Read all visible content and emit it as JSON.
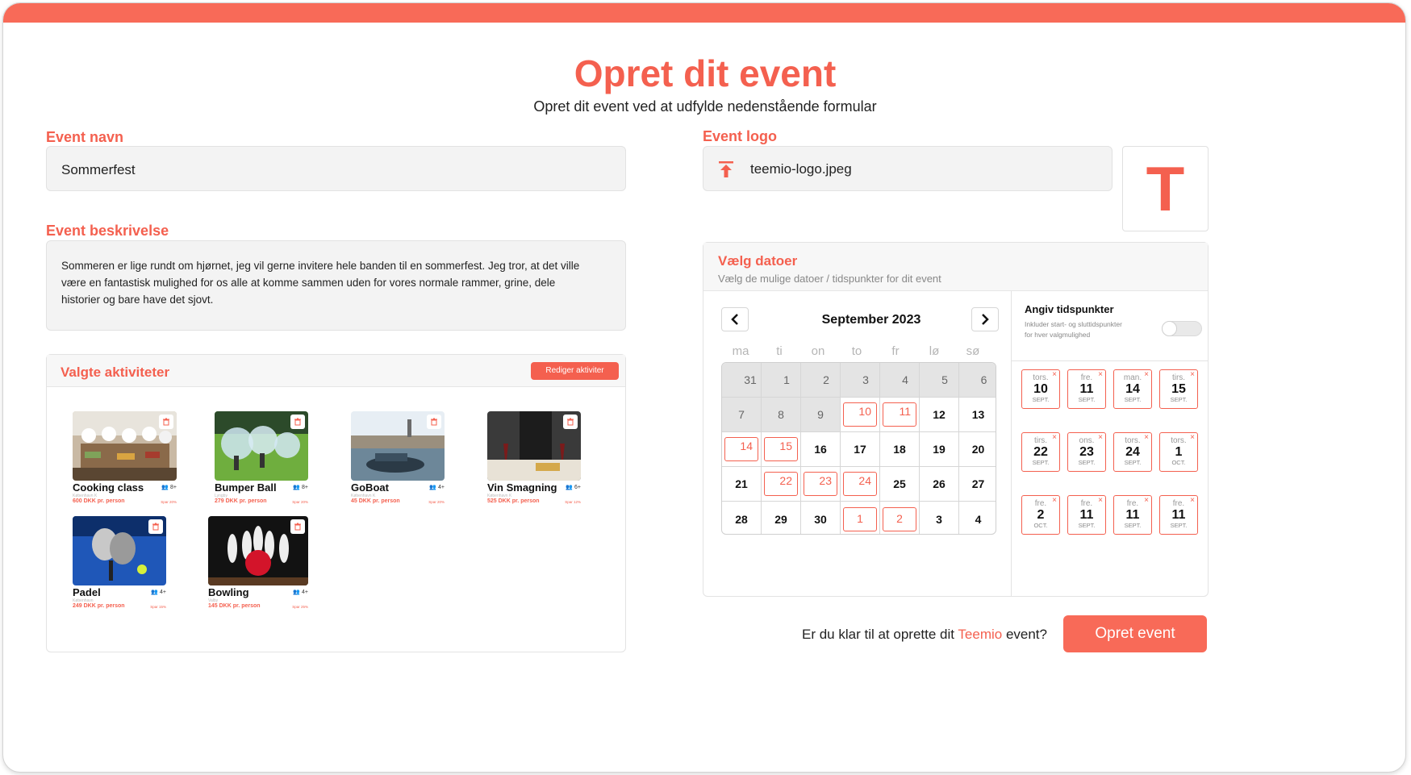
{
  "header": {
    "title": "Opret dit event",
    "subtitle": "Opret dit event ved at udfylde nedenstående formular"
  },
  "event_name": {
    "label": "Event navn",
    "value": "Sommerfest"
  },
  "event_description": {
    "label": "Event beskrivelse",
    "value": "Sommeren er lige rundt om hjørnet, jeg vil gerne invitere hele banden til en sommerfest. Jeg tror, at det ville være en fantastisk mulighed for os alle at komme sammen uden for vores normale rammer, grine, dele historier og bare have det sjovt."
  },
  "activities": {
    "title": "Valgte aktiviteter",
    "edit_label": "Rediger aktiviter",
    "items": [
      {
        "name": "Cooking class",
        "capacity": "8+",
        "location": "København K",
        "price": "600 DKK pr. person",
        "save": "Spar 20%"
      },
      {
        "name": "Bumper Ball",
        "capacity": "8+",
        "location": "Lyngby",
        "price": "279 DKK pr. person",
        "save": "Spar 20%"
      },
      {
        "name": "GoBoat",
        "capacity": "4+",
        "location": "København K",
        "price": "45 DKK pr. person",
        "save": "Spar 20%"
      },
      {
        "name": "Vin Smagning",
        "capacity": "6+",
        "location": "København K",
        "price": "525 DKK pr. person",
        "save": "Spar 12%"
      },
      {
        "name": "Padel",
        "capacity": "4+",
        "location": "København",
        "price": "249 DKK pr. person",
        "save": "Spar 15%"
      },
      {
        "name": "Bowling",
        "capacity": "4+",
        "location": "Valby",
        "price": "145 DKK pr. person",
        "save": "Spar 25%"
      }
    ]
  },
  "event_logo": {
    "label": "Event logo",
    "filename": "teemio-logo.jpeg",
    "preview_letter": "T"
  },
  "dates": {
    "title": "Vælg datoer",
    "subtitle": "Vælg de mulige datoer / tidspunkter for dit event",
    "month": "September 2023",
    "weekdays": [
      "ma",
      "ti",
      "on",
      "to",
      "fr",
      "lø",
      "sø"
    ],
    "days": [
      [
        "31",
        "1",
        "2",
        "3",
        "4",
        "5",
        "6"
      ],
      [
        "7",
        "8",
        "9",
        "10",
        "11",
        "12",
        "13"
      ],
      [
        "14",
        "15",
        "16",
        "17",
        "18",
        "19",
        "20"
      ],
      [
        "21",
        "22",
        "23",
        "24",
        "25",
        "26",
        "27"
      ],
      [
        "28",
        "29",
        "30",
        "1",
        "2",
        "3",
        "4"
      ]
    ]
  },
  "times": {
    "title": "Angiv tidspunkter",
    "subtitle_line1": "Inkluder start- og sluttidspunkter",
    "subtitle_line2": "for hver valgmulighed",
    "toggle_on": false,
    "chips": [
      {
        "day": "tors.",
        "num": "10",
        "mon": "SEPT."
      },
      {
        "day": "fre.",
        "num": "11",
        "mon": "SEPT."
      },
      {
        "day": "man.",
        "num": "14",
        "mon": "SEPT."
      },
      {
        "day": "tirs.",
        "num": "15",
        "mon": "SEPT."
      },
      {
        "day": "tirs.",
        "num": "22",
        "mon": "SEPT."
      },
      {
        "day": "ons.",
        "num": "23",
        "mon": "SEPT."
      },
      {
        "day": "tors.",
        "num": "24",
        "mon": "SEPT."
      },
      {
        "day": "tors.",
        "num": "1",
        "mon": "OCT."
      },
      {
        "day": "fre.",
        "num": "2",
        "mon": "OCT."
      },
      {
        "day": "fre.",
        "num": "11",
        "mon": "SEPT."
      },
      {
        "day": "fre.",
        "num": "11",
        "mon": "SEPT."
      },
      {
        "day": "fre.",
        "num": "11",
        "mon": "SEPT."
      }
    ],
    "remove_symbol": "×"
  },
  "footer": {
    "cta_prefix": "Er du klar til at oprette dit ",
    "cta_brand": "Teemio",
    "cta_suffix": " event?",
    "button_label": "Opret event"
  },
  "colors": {
    "accent": "#f4604f",
    "topbar": "#f86a58"
  }
}
